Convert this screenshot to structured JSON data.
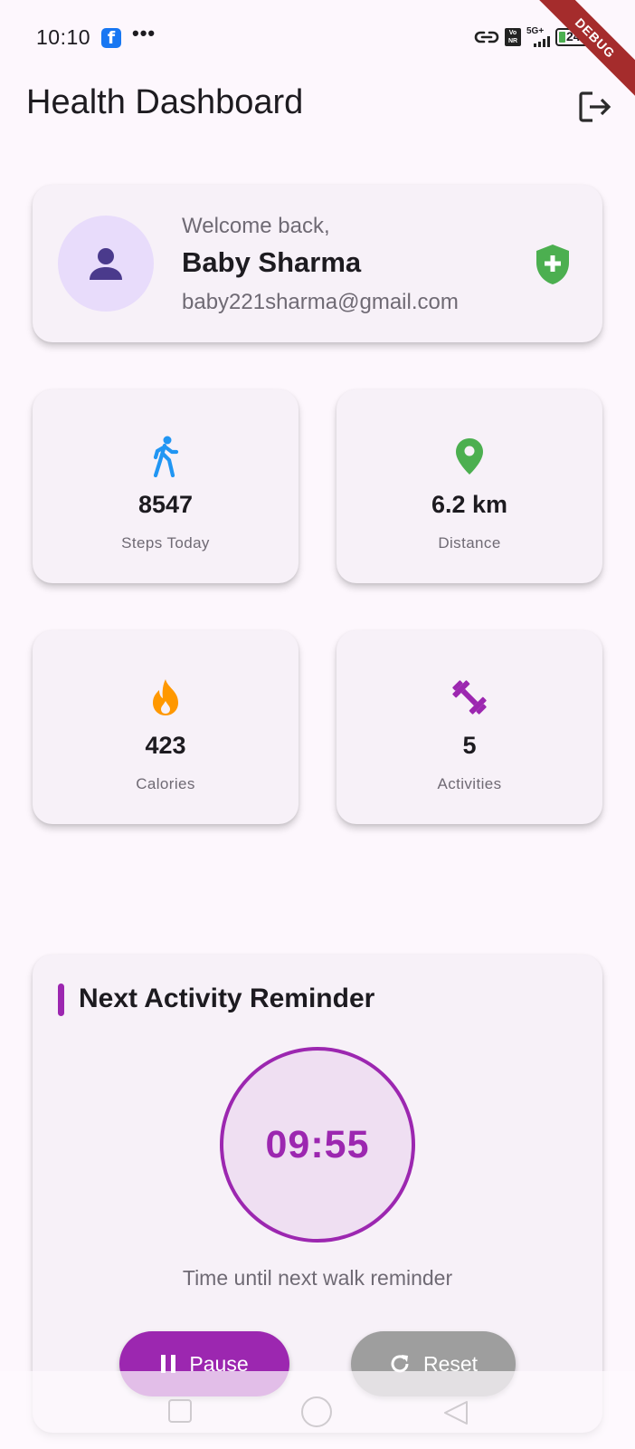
{
  "status_bar": {
    "time": "10:10",
    "more": "•••",
    "vonr": "Vo NR",
    "network": "5G+",
    "battery": "24",
    "debug": "DEBUG"
  },
  "app_bar": {
    "title": "Health Dashboard"
  },
  "profile": {
    "welcome": "Welcome back,",
    "name": "Baby Sharma",
    "email": "baby221sharma@gmail.com"
  },
  "stats": [
    {
      "value": "8547",
      "label": "Steps Today",
      "icon": "walk-icon",
      "color": "#2196f3"
    },
    {
      "value": "6.2 km",
      "label": "Distance",
      "icon": "location-pin-icon",
      "color": "#4caf50"
    },
    {
      "value": "423",
      "label": "Calories",
      "icon": "fire-icon",
      "color": "#ff9800"
    },
    {
      "value": "5",
      "label": "Activities",
      "icon": "dumbbell-icon",
      "color": "#9c27b0"
    }
  ],
  "reminder": {
    "title": "Next Activity Reminder",
    "timer": "09:55",
    "subtitle": "Time until next walk reminder",
    "pause_label": "Pause",
    "reset_label": "Reset"
  },
  "colors": {
    "accent": "#9c27b0",
    "shield": "#4caf50",
    "avatar_bg": "#e8dcfb",
    "avatar_icon": "#4a3a8c"
  }
}
